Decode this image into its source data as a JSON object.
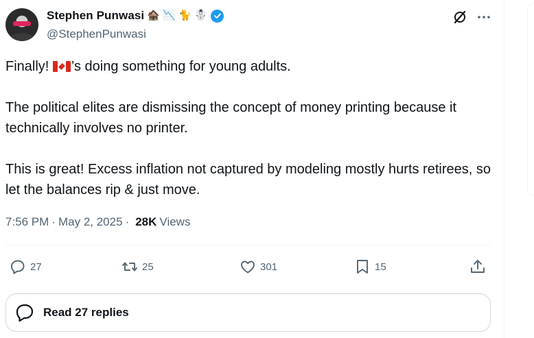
{
  "author": {
    "display_name": "Stephen Punwasi",
    "handle": "@StephenPunwasi",
    "name_emojis": [
      "🏚️",
      "📉",
      "🐈",
      "☃️"
    ],
    "verified": true,
    "verified_color": "#1d9bf0"
  },
  "tweet": {
    "line1_before_flag": "Finally! ",
    "line1_after_flag": "’s doing something for young adults.",
    "paragraph2": "The political elites are dismissing the concept of money printing because it technically involves no printer.",
    "paragraph3": "This is great! Excess inflation not captured by modeling mostly hurts retirees, so let the balances rip & just move."
  },
  "meta": {
    "time": "7:56 PM",
    "separator": "·",
    "date": "May 2, 2025",
    "views_count": "28K",
    "views_label": "Views"
  },
  "actions": {
    "replies": "27",
    "reposts": "25",
    "likes": "301",
    "bookmarks": "15"
  },
  "read_replies_label": "Read 27 replies",
  "icons": {
    "grok": "grok-icon",
    "more": "more-icon",
    "reply": "reply-icon",
    "repost": "repost-icon",
    "like": "heart-icon",
    "bookmark": "bookmark-icon",
    "share": "share-icon",
    "replies_bubble": "chat-bubble-icon"
  },
  "colors": {
    "text": "#0f1419",
    "secondary": "#536471",
    "border": "#cfd9de",
    "flag_red": "#d52b1e"
  }
}
